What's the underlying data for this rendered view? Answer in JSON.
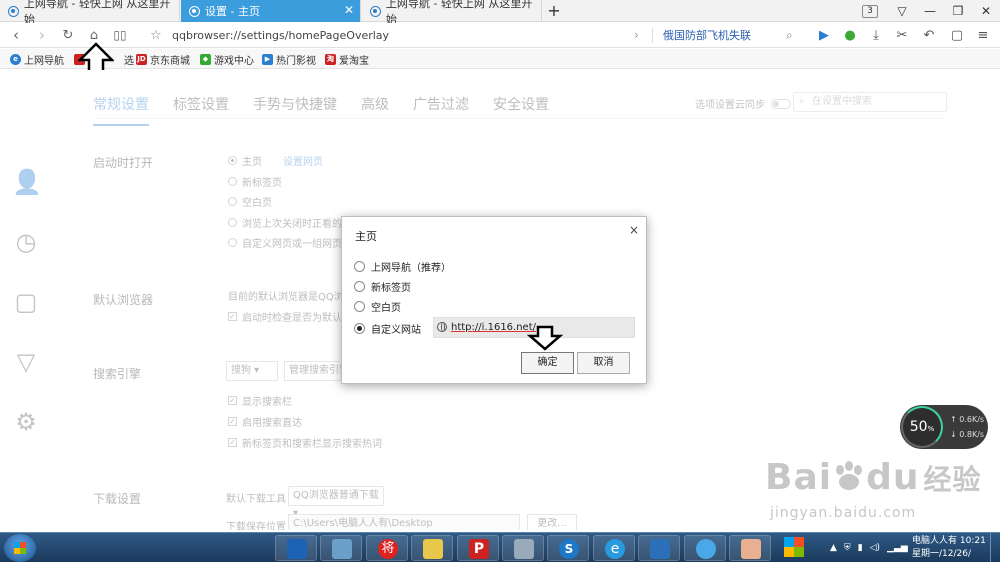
{
  "tabs": [
    {
      "title": "上网导航 - 轻快上网 从这里开始",
      "active": false
    },
    {
      "title": "设置 - 主页",
      "active": true
    },
    {
      "title": "上网导航 - 轻快上网 从这里开始",
      "active": false
    }
  ],
  "new_tab": "+",
  "window": {
    "tab_count": "3"
  },
  "address": {
    "url": "qqbrowser://settings/homePageOverlay",
    "hot_news": "俄国防部飞机失联"
  },
  "bookmarks": [
    {
      "label": "上网导航",
      "icon": "e-icon",
      "color": "#2a7fd0"
    },
    {
      "label": "选",
      "icon": "pick-icon",
      "color": "#c22"
    },
    {
      "label": "京东商城",
      "icon": "jd-icon",
      "color": "#c22"
    },
    {
      "label": "游戏中心",
      "icon": "game-icon",
      "color": "#3a3"
    },
    {
      "label": "热门影视",
      "icon": "video-icon",
      "color": "#2a7fd0"
    },
    {
      "label": "爱淘宝",
      "icon": "taobao-icon",
      "color": "#c22"
    }
  ],
  "settings": {
    "tabs": [
      "常规设置",
      "标签设置",
      "手势与快捷键",
      "高级",
      "广告过滤",
      "安全设置"
    ],
    "sync_label": "选项设置云同步",
    "search_placeholder": "在设置中搜索",
    "startup": {
      "title": "启动时打开",
      "options": [
        "主页",
        "新标签页",
        "空白页",
        "浏览上次关闭时正看的网页",
        "自定义网页或一组网页"
      ],
      "home_link": "设置网页"
    },
    "default_browser": {
      "title": "默认浏览器",
      "desc": "目前的默认浏览器是QQ浏览器",
      "check": "启动时检查是否为默认浏览器"
    },
    "search_engine": {
      "title": "搜索引擎",
      "engine": "搜狗",
      "manage": "管理搜索引擎",
      "checks": [
        "显示搜索栏",
        "启用搜索直达",
        "新标签页和搜索栏显示搜索热词"
      ]
    },
    "download": {
      "title": "下载设置",
      "tool_label": "默认下载工具",
      "tool_value": "QQ浏览器普通下载",
      "path_label": "下载保存位置",
      "path_value": "C:\\Users\\电脑人人有\\Desktop",
      "change": "更改..."
    }
  },
  "dialog": {
    "title": "主页",
    "close": "×",
    "options": [
      "上网导航（推荐）",
      "新标签页",
      "空白页",
      "自定义网站"
    ],
    "selected_index": 3,
    "custom_url": "http://i.1616.net/",
    "ok": "确定",
    "cancel": "取消"
  },
  "speed_widget": {
    "percent": "50",
    "unit": "%",
    "up": "0.6K/s",
    "down": "0.8K/s"
  },
  "watermark": {
    "brand": "Bai",
    "brand2": "du",
    "cn": "经验",
    "site": "jingyan.baidu.com"
  },
  "taskbar": {
    "clock_name": "电脑人人有 10:21",
    "clock_date": "星期一/12/26/"
  }
}
